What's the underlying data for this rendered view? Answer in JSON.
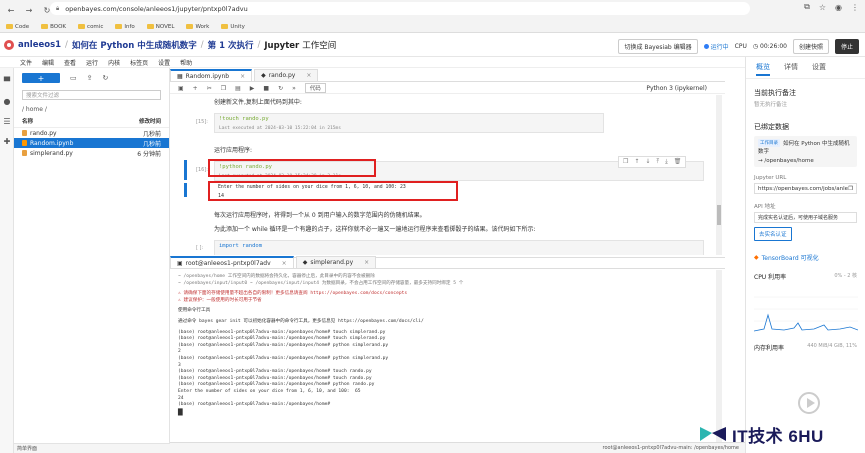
{
  "browser": {
    "url": "openbayes.com/console/anleeos1/jupyter/pntxp0l7advu",
    "bookmarks": [
      "Code",
      "BOOK",
      "comic",
      "Info",
      "NOVEL",
      "Work",
      "Unity"
    ]
  },
  "header": {
    "user": "anleeos1",
    "title": "如何在 Python 中生成随机数字",
    "run": "第 1 次执行",
    "app": "Jupyter",
    "app_suffix": "工作空间",
    "switch_btn": "切换成 Bayesiab 编辑器",
    "status": "运行中",
    "cpu_label": "CPU",
    "timer": "00:26:00",
    "snapshot_btn": "创建快照",
    "stop_btn": "停止"
  },
  "menubar": [
    "文件",
    "编辑",
    "查看",
    "运行",
    "内核",
    "标签页",
    "设置",
    "帮助"
  ],
  "filebrowser": {
    "new_label": "+",
    "filter_placeholder": "搜索文件过滤",
    "path": "/ home /",
    "col_name": "名称",
    "col_modified": "修改时间",
    "files": [
      {
        "name": "rando.py",
        "time": "几秒前",
        "selected": false
      },
      {
        "name": "Random.ipynb",
        "time": "几秒前",
        "selected": true
      },
      {
        "name": "simplerand.py",
        "time": "6 分钟前",
        "selected": false
      }
    ],
    "bottom_label": "简单界面"
  },
  "notebook": {
    "tabs": [
      {
        "label": "Random.ipynb",
        "active": true
      },
      {
        "label": "rando.py",
        "active": false
      }
    ],
    "cell_type": "代码",
    "kernel": "Python 3 (ipykernel)",
    "text1": "创建新文件,复制上面代码到其中:",
    "cell1_prompt": "[15]:",
    "cell1_code": "!touch rando.py",
    "cell1_meta": "Last executed at 2024-03-10 15:22:04 in 215ms",
    "text2": "运行应用程序:",
    "cell2_prompt": "[16]:",
    "cell2_code": "!python rando.py",
    "cell2_meta": "Last executed at 2024-03-10 15:24:38 in 3.11s",
    "output1": "Enter the number of sides on your dice from 1, 6, 10, and 100:  23",
    "output2": "14",
    "text3": "每次运行应用程序时，将得到一个从 0 到用户输入的数字范围内的伪随机结果。",
    "text4": "为此添加一个 while 循环是一个有趣的点子，这样你就不必一遍又一遍地运行程序来查看掷骰子的结果。该代码如下所示:",
    "cell3_prompt": "[ ]:",
    "cell3_code": "import random"
  },
  "terminal": {
    "tabs": [
      {
        "label": "root@anleeos1-pntxp0l7adv",
        "active": true
      },
      {
        "label": "simplerand.py",
        "active": false
      }
    ],
    "lines": [
      {
        "t": "~ /openbayes/home 工作空间内的数据将会持久化，容器停止后，此目录中的内容不会被删除",
        "c": "gray"
      },
      {
        "t": "~ /openbayes/input/input0 ~ /openbayes/input/input4 为数据目录，不会占用工作空间的存储容量，最多支持同时绑定 5 个",
        "c": "gray"
      },
      {
        "t": "",
        "c": "gap"
      },
      {
        "t": "⚠ 请确保下面的存储使用量不超出各自的限制！更多信息请查阅 https://openbayes.com/docs/concepts",
        "c": "warn"
      },
      {
        "t": "⚠ 建议保护：一般使用的时长可用于节省",
        "c": "warn"
      },
      {
        "t": "",
        "c": "gap"
      },
      {
        "t": "使用命令行工具",
        "c": ""
      },
      {
        "t": "",
        "c": "gap"
      },
      {
        "t": "通过命令 bayes gear init 可以初始化容器中的命令行工具，更多信息见 https://openbayes.com/docs/cli/",
        "c": ""
      },
      {
        "t": "",
        "c": "gap"
      },
      {
        "t": "(base) root@anleeos1-pntxp0l7advu-main:/openbayes/home# touch simplerand.py",
        "c": ""
      },
      {
        "t": "(base) root@anleeos1-pntxp0l7advu-main:/openbayes/home# touch simplerand.py",
        "c": ""
      },
      {
        "t": "(base) root@anleeos1-pntxp0l7advu-main:/openbayes/home# python simplerand.py",
        "c": ""
      },
      {
        "t": "2",
        "c": ""
      },
      {
        "t": "(base) root@anleeos1-pntxp0l7advu-main:/openbayes/home# python simplerand.py",
        "c": ""
      },
      {
        "t": "3",
        "c": ""
      },
      {
        "t": "(base) root@anleeos1-pntxp0l7advu-main:/openbayes/home# touch rando.py",
        "c": ""
      },
      {
        "t": "(base) root@anleeos1-pntxp0l7advu-main:/openbayes/home# touch rando.py",
        "c": ""
      },
      {
        "t": "(base) root@anleeos1-pntxp0l7advu-main:/openbayes/home# python rando.py",
        "c": ""
      },
      {
        "t": "Enter the number of sides on your dice from 1, 6, 10, and 100:  65",
        "c": ""
      },
      {
        "t": "24",
        "c": ""
      },
      {
        "t": "(base) root@anleeos1-pntxp0l7advu-main:/openbayes/home# ",
        "c": ""
      }
    ],
    "status": "root@anleeos1-pntxp0l7advu-main: /openbayes/home"
  },
  "rightpanel": {
    "tabs": [
      "概览",
      "详情",
      "设置"
    ],
    "section1_title": "当前执行备注",
    "section1_sub": "暂无执行备注",
    "section2_title": "已绑定数据",
    "bound_tag": "工作目录",
    "bound_name": "如何在 Python 中生成随机数字",
    "bound_path": "→ /openbayes/home",
    "jupyter_label": "Jupyter URL",
    "jupyter_url": "https://openbayes.com/jobs/anleeo",
    "api_label": "API 地址",
    "api_value": "完成实名认证后，可使用子域名服务",
    "verify_btn": "去实名认证",
    "tensorboard": "TensorBoard 可视化",
    "cpu_title": "CPU 利用率",
    "cpu_value": "0% - 2 核",
    "mem_title": "内存利用率",
    "mem_value": "440 MiB/4 GiB, 11%"
  },
  "watermark": "IT技术 6HU",
  "colors": {
    "accent": "#1976d2",
    "highlight": "#e02020",
    "brand": "#1f3a93"
  }
}
